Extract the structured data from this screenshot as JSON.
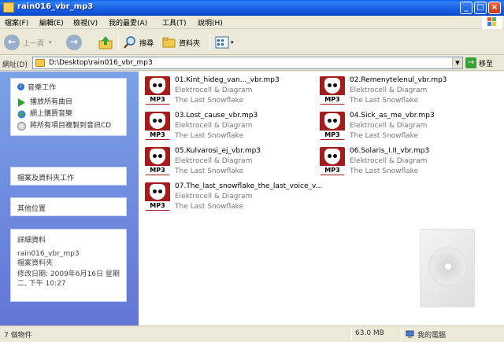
{
  "window": {
    "title": "rain016_vbr_mp3",
    "controls": {
      "minimize": "_",
      "maximize": "□",
      "close": "×"
    }
  },
  "menu": [
    {
      "label": "檔案(F)"
    },
    {
      "label": "編輯(E)"
    },
    {
      "label": "檢視(V)"
    },
    {
      "label": "我的最愛(A)"
    },
    {
      "label": "工具(T)"
    },
    {
      "label": "說明(H)"
    }
  ],
  "toolbar": {
    "back_label": "上一頁",
    "search_label": "搜尋",
    "folders_label": "資料夾"
  },
  "address": {
    "label": "網址(D)",
    "value": "D:\\Desktop\\rain016_vbr_mp3",
    "go_label": "移至"
  },
  "tasks": {
    "music": {
      "title": "音樂工作",
      "items": [
        {
          "label": "播放所有曲目",
          "icon": "play-icon"
        },
        {
          "label": "網上購買音樂",
          "icon": "globe-icon"
        },
        {
          "label": "將所有項目複製到音訊CD",
          "icon": "cd-burn-icon"
        }
      ]
    },
    "file_folder_title": "檔案及資料夾工作",
    "other_places_title": "其他位置",
    "details": {
      "title": "詳細資料",
      "name": "rain016_vbr_mp3",
      "type": "檔案資料夾",
      "modified": "修改日期: 2009年6月16日 星期二, 下午 10:27"
    }
  },
  "files": [
    {
      "name": "01.Kint_hideg_van..._vbr.mp3",
      "artist": "Elektrocell & Diagram",
      "album": "The Last Snowflake",
      "icon_label": "MP3"
    },
    {
      "name": "02.Remenytelenul_vbr.mp3",
      "artist": "Elektrocell & Diagram",
      "album": "The Last Snowflake",
      "icon_label": "MP3"
    },
    {
      "name": "03.Lost_cause_vbr.mp3",
      "artist": "Elektrocell & Diagram",
      "album": "The Last Snowflake",
      "icon_label": "MP3"
    },
    {
      "name": "04.Sick_as_me_vbr.mp3",
      "artist": "Elektrocell & Diagram",
      "album": "The Last Snowflake",
      "icon_label": "MP3"
    },
    {
      "name": "05.Kulvarosi_ej_vbr.mp3",
      "artist": "Elektrocell & Diagram",
      "album": "The Last Snowflake",
      "icon_label": "MP3"
    },
    {
      "name": "06.Solaris_I.II_vbr.mp3",
      "artist": "Elektrocell & Diagram",
      "album": "The Last Snowflake",
      "icon_label": "MP3"
    },
    {
      "name": "07.The_last_snowflake_the_last_voice_v...",
      "artist": "Elektrocell & Diagram",
      "album": "The Last Snowflake",
      "icon_label": "MP3"
    }
  ],
  "status": {
    "count": "7 個物件",
    "size": "63.0 MB",
    "location": "我的電腦"
  }
}
